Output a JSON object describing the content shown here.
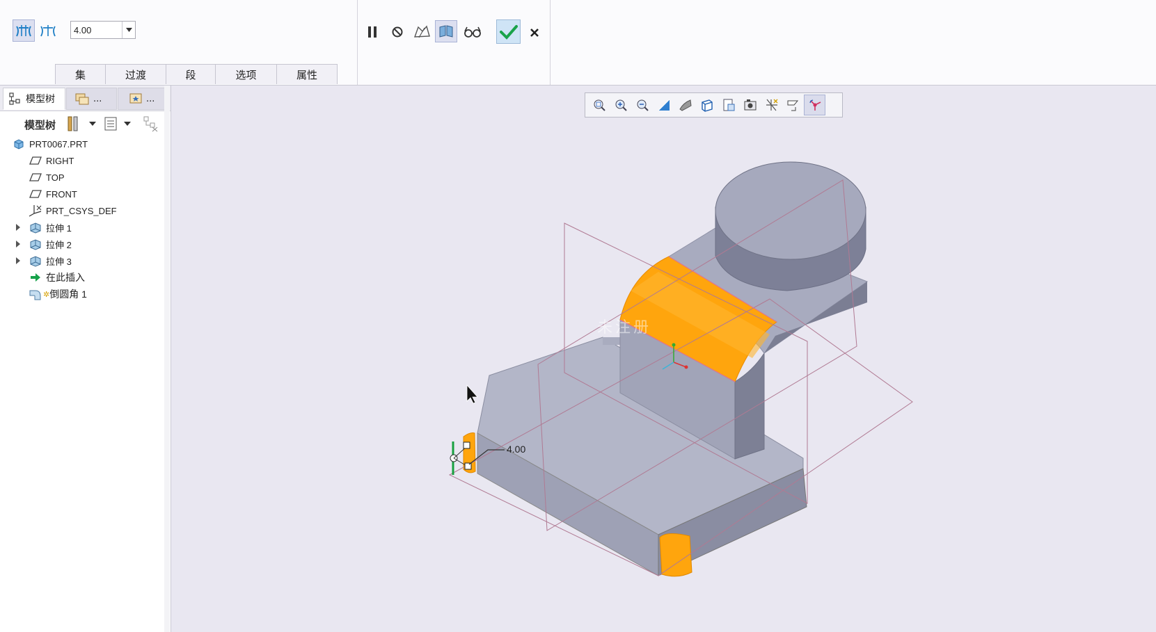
{
  "dashboard": {
    "depth_value": "4.00",
    "tabs": [
      {
        "label": "集"
      },
      {
        "label": "过渡"
      },
      {
        "label": "段"
      },
      {
        "label": "选项"
      },
      {
        "label": "属性"
      }
    ]
  },
  "left_panel": {
    "tabs": [
      {
        "label": "模型树"
      },
      {
        "label": "..."
      },
      {
        "label": "..."
      }
    ],
    "toolbar_label": "模型树",
    "tree": [
      {
        "label": "PRT0067.PRT",
        "icon": "part-icon"
      },
      {
        "label": "RIGHT",
        "icon": "datum-plane-icon"
      },
      {
        "label": "TOP",
        "icon": "datum-plane-icon"
      },
      {
        "label": "FRONT",
        "icon": "datum-plane-icon"
      },
      {
        "label": "PRT_CSYS_DEF",
        "icon": "csys-icon"
      },
      {
        "label": "拉伸 1",
        "icon": "extrude-icon"
      },
      {
        "label": "拉伸 2",
        "icon": "extrude-icon"
      },
      {
        "label": "拉伸 3",
        "icon": "extrude-icon"
      },
      {
        "label": "在此插入",
        "icon": "insert-here-icon"
      },
      {
        "label": "倒圆角 1",
        "icon": "round-icon"
      }
    ]
  },
  "viewport": {
    "dimension_label": "4.00",
    "watermark": "未注册"
  },
  "colors": {
    "accent": "#ffa500",
    "model": "#a0a3b7",
    "datum": "#b07a93",
    "background": "#e9e7f1"
  }
}
